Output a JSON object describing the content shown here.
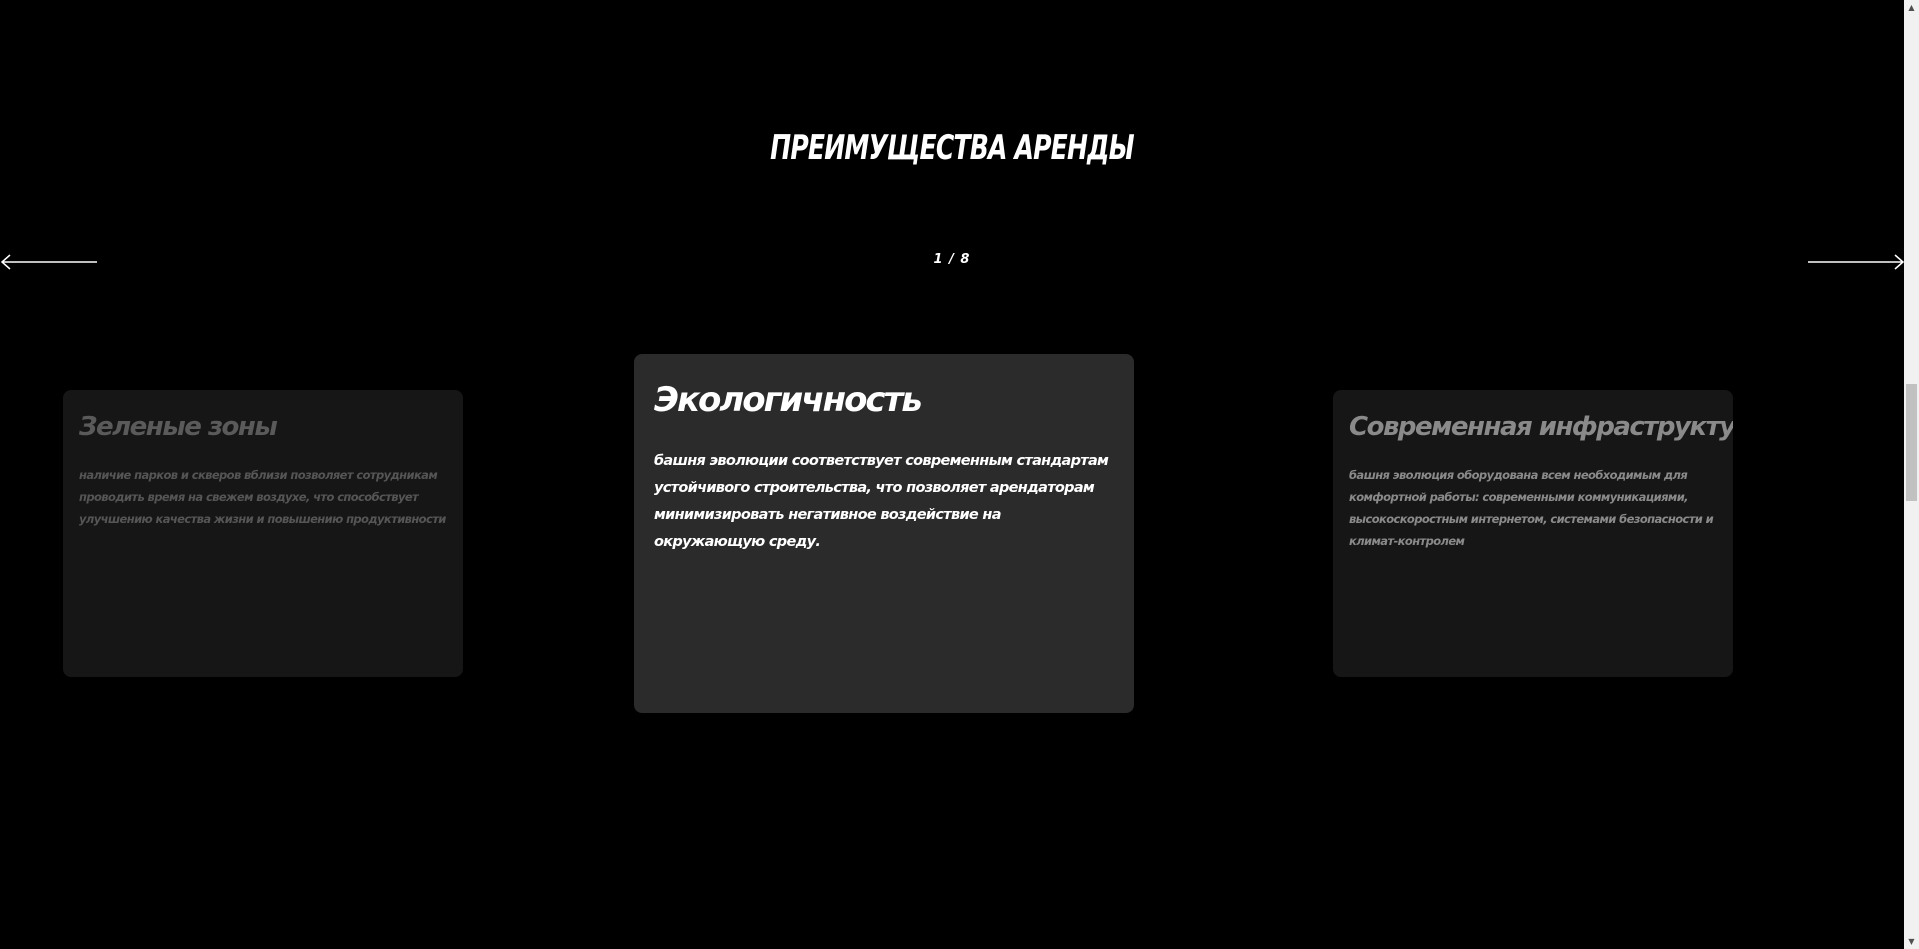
{
  "section": {
    "title": "ПРЕИМУЩЕСТВА АРЕНДЫ"
  },
  "slider": {
    "counter": "1 / 8",
    "prev_icon": "arrow-left-icon",
    "next_icon": "arrow-right-icon"
  },
  "cards": [
    {
      "title": "Зеленые зоны",
      "text": "Наличие парков и скверов вблизи позволяет сотрудникам проводить время на свежем воздухе, что способствует улучшению качества жизни и повышению продуктивности"
    },
    {
      "title": "Экологичность",
      "text": " Башня Эволюции соответствует современным стандартам устойчивого строительства, что позволяет арендаторам минимизировать негативное воздействие на окружающую среду."
    },
    {
      "title": "Современная инфраструктура",
      "text": "Башня Эволюция оборудована всем необходимым для комфортной работы: современными коммуникациями, высокоскоростным интернетом, системами безопасности и климат-контролем"
    }
  ],
  "scrollbar": {
    "up_icon": "scroll-up-icon",
    "down_icon": "scroll-down-icon"
  }
}
